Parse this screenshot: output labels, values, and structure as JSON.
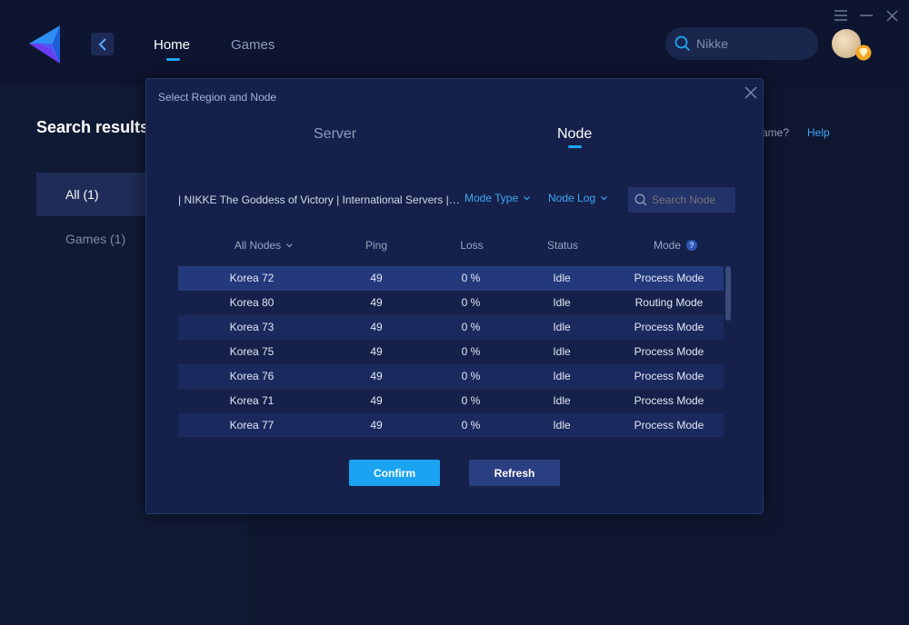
{
  "header": {
    "tabs": [
      {
        "label": "Home",
        "active": true
      },
      {
        "label": "Games",
        "active": false
      }
    ],
    "search": {
      "value": "Nikke",
      "placeholder": ""
    },
    "accent_color": "#1fa6f5"
  },
  "left_panel": {
    "title": "Search results",
    "filters": [
      {
        "label": "All (1)",
        "active": true
      },
      {
        "label": "Games (1)",
        "active": false
      }
    ]
  },
  "background": {
    "partial_question": "ame?",
    "help_link": "Help"
  },
  "modal": {
    "title": "Select Region and Node",
    "tabs": [
      {
        "label": "Server",
        "active": false
      },
      {
        "label": "Node",
        "active": true
      }
    ],
    "path": "| NIKKE The Goddess of Victory | International Servers | So...",
    "mode_type_label": "Mode Type",
    "node_log_label": "Node Log",
    "search_placeholder": "Search Node",
    "columns": {
      "nodes": "All Nodes",
      "ping": "Ping",
      "loss": "Loss",
      "status": "Status",
      "mode": "Mode"
    },
    "rows": [
      {
        "node": "Korea 72",
        "ping": "49",
        "loss": "0 %",
        "status": "Idle",
        "mode": "Process Mode"
      },
      {
        "node": "Korea 80",
        "ping": "49",
        "loss": "0 %",
        "status": "Idle",
        "mode": "Routing Mode"
      },
      {
        "node": "Korea 73",
        "ping": "49",
        "loss": "0 %",
        "status": "Idle",
        "mode": "Process Mode"
      },
      {
        "node": "Korea 75",
        "ping": "49",
        "loss": "0 %",
        "status": "Idle",
        "mode": "Process Mode"
      },
      {
        "node": "Korea 76",
        "ping": "49",
        "loss": "0 %",
        "status": "Idle",
        "mode": "Process Mode"
      },
      {
        "node": "Korea 71",
        "ping": "49",
        "loss": "0 %",
        "status": "Idle",
        "mode": "Process Mode"
      },
      {
        "node": "Korea 77",
        "ping": "49",
        "loss": "0 %",
        "status": "Idle",
        "mode": "Process Mode"
      }
    ],
    "confirm_label": "Confirm",
    "refresh_label": "Refresh"
  }
}
